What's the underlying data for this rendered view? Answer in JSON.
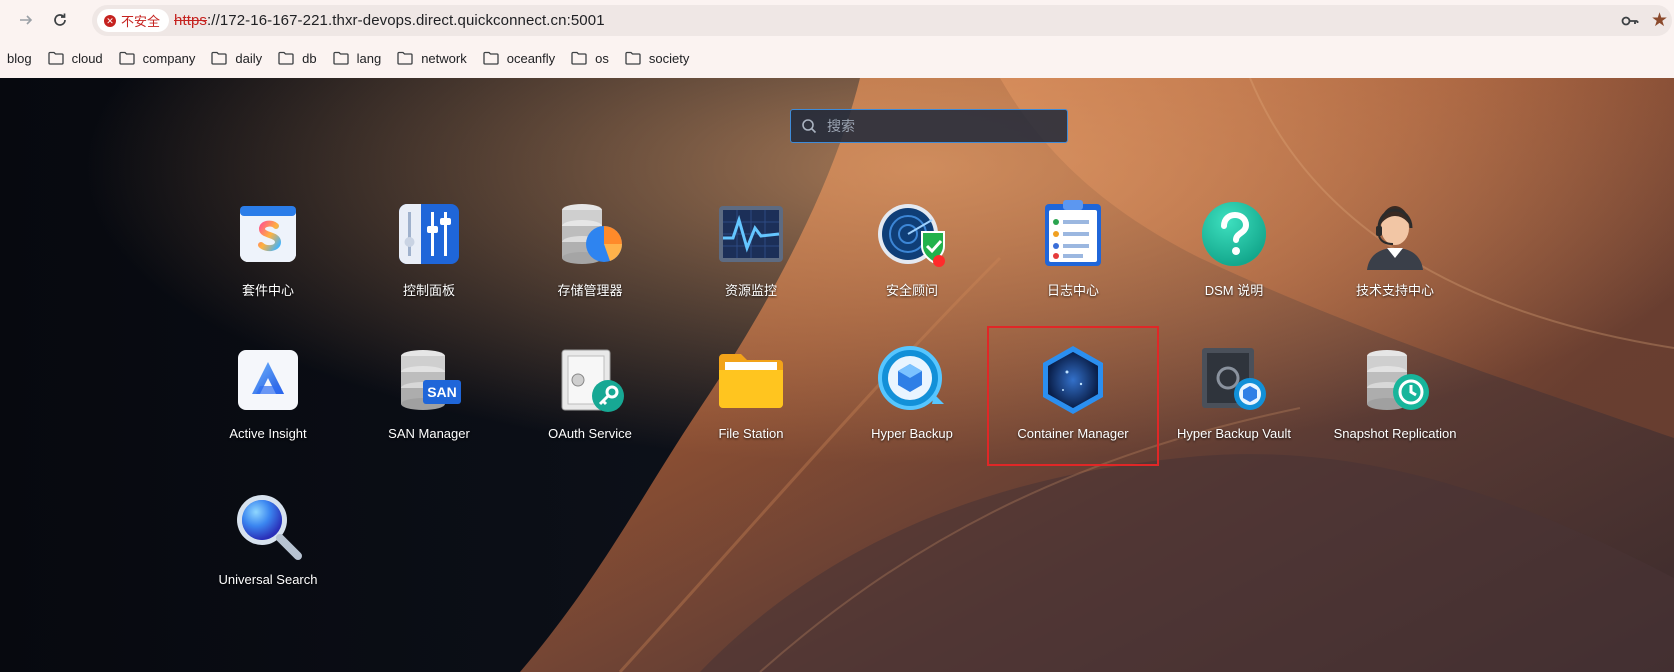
{
  "browser": {
    "security_label": "不安全",
    "url_protocol": "https",
    "url_rest": "://172-16-167-221.thxr-devops.direct.quickconnect.cn:5001",
    "bookmarks": [
      {
        "label": "blog",
        "folder": false
      },
      {
        "label": "cloud",
        "folder": true
      },
      {
        "label": "company",
        "folder": true
      },
      {
        "label": "daily",
        "folder": true
      },
      {
        "label": "db",
        "folder": true
      },
      {
        "label": "lang",
        "folder": true
      },
      {
        "label": "network",
        "folder": true
      },
      {
        "label": "oceanfly",
        "folder": true
      },
      {
        "label": "os",
        "folder": true
      },
      {
        "label": "society",
        "folder": true
      }
    ]
  },
  "search": {
    "placeholder": "搜索"
  },
  "apps": [
    {
      "label": "套件中心",
      "icon": "package-center-icon"
    },
    {
      "label": "控制面板",
      "icon": "control-panel-icon"
    },
    {
      "label": "存储管理器",
      "icon": "storage-manager-icon"
    },
    {
      "label": "资源监控",
      "icon": "resource-monitor-icon"
    },
    {
      "label": "安全顾问",
      "icon": "security-advisor-icon"
    },
    {
      "label": "日志中心",
      "icon": "log-center-icon"
    },
    {
      "label": "DSM 说明",
      "icon": "dsm-help-icon"
    },
    {
      "label": "技术支持中心",
      "icon": "support-center-icon"
    },
    {
      "label": "Active Insight",
      "icon": "active-insight-icon"
    },
    {
      "label": "SAN Manager",
      "icon": "san-manager-icon"
    },
    {
      "label": "OAuth Service",
      "icon": "oauth-service-icon"
    },
    {
      "label": "File Station",
      "icon": "file-station-icon"
    },
    {
      "label": "Hyper Backup",
      "icon": "hyper-backup-icon"
    },
    {
      "label": "Container Manager",
      "icon": "container-manager-icon",
      "selected": true
    },
    {
      "label": "Hyper Backup Vault",
      "icon": "hyper-backup-vault-icon"
    },
    {
      "label": "Snapshot Replication",
      "icon": "snapshot-replication-icon"
    },
    {
      "label": "Universal Search",
      "icon": "universal-search-icon"
    }
  ],
  "colors": {
    "selection_outline": "#e02727",
    "insecure_red": "#c5221f",
    "search_border": "#3f8bd7"
  }
}
